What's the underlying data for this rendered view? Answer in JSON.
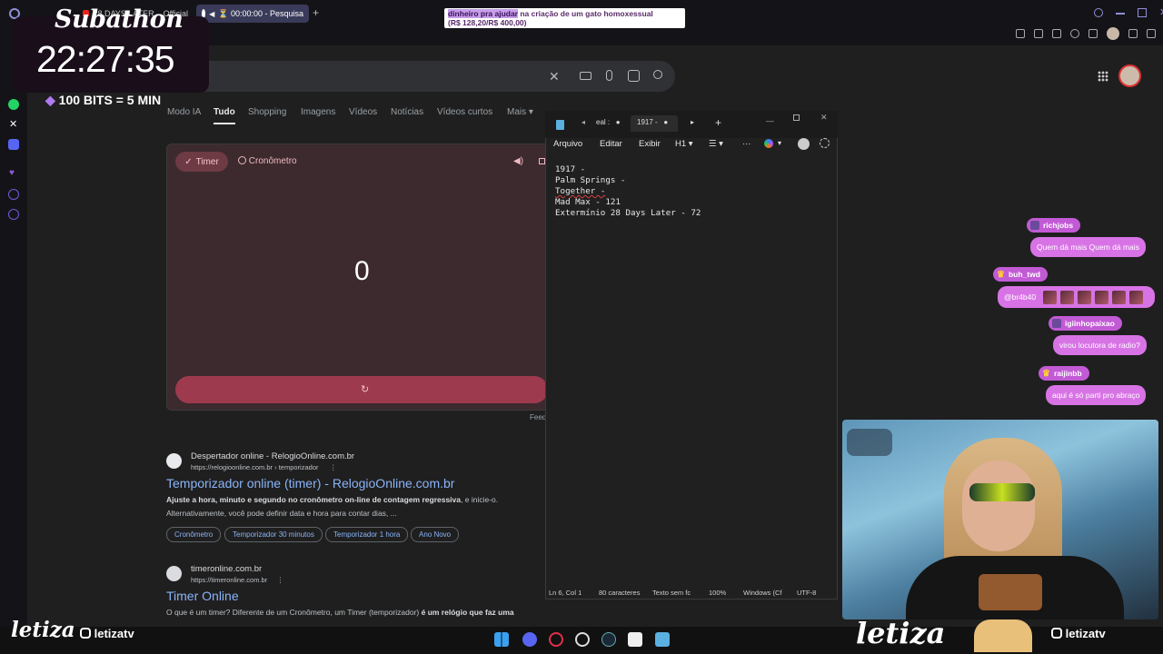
{
  "browser": {
    "tabs": [
      {
        "label": "28 DAYS LATER – Official"
      },
      {
        "label": "⏳ 00:00:00 - Pesquisa"
      }
    ],
    "new_tab": "+"
  },
  "overlay": {
    "subathon": "Subathon",
    "clock": "22:27:35",
    "bits": "100 BITS = 5 MIN",
    "donation_highlight": "dinheiro pra ajudar",
    "donation_text": " na criação de um gato homoxessual",
    "donation_amount": "(R$ 128,20/R$ 400,00)",
    "brand": "letiza",
    "handle": "letizatv",
    "brand_right": "letiza",
    "handle_right": "letizatv"
  },
  "google": {
    "nav": [
      "Modo IA",
      "Tudo",
      "Shopping",
      "Imagens",
      "Vídeos",
      "Notícias",
      "Vídeos curtos",
      "Mais"
    ],
    "selected_nav": "Tudo",
    "timer_tab": "Timer",
    "stopwatch_tab": "Cronômetro",
    "timer_value": "0",
    "feedback": "Feed",
    "results": [
      {
        "site": "Despertador online - RelogioOnline.com.br",
        "url": "https://relogioonline.com.br › temporizador",
        "title": "Temporizador online (timer) - RelogioOnline.com.br",
        "snippet_bold": "Ajuste a hora, minuto e segundo no cronômetro on-line de contagem regressiva",
        "snippet_rest": ", e inicie-o. Alternativamente, você pode definir data e hora para contar dias, ...",
        "chips": [
          "Cronômetro",
          "Temporizador 30 minutos",
          "Temporizador 1 hora",
          "Ano Novo"
        ]
      },
      {
        "site": "timeronline.com.br",
        "url": "https://timeronline.com.br",
        "title": "Timer Online",
        "snippet_rest": "O que é um timer? Diferente de um Cronômetro, um Timer (temporizador) ",
        "snippet_bold": "é um relógio que faz uma"
      }
    ]
  },
  "notepad": {
    "tabs": [
      "eal :",
      "1917 -"
    ],
    "menu": [
      "Arquivo",
      "Editar",
      "Exibir",
      "H1"
    ],
    "lines": [
      "1917 -",
      "Palm Springs -",
      "Together -",
      "Mad Max - 121",
      "Extermínio 28 Days Later - 72"
    ],
    "status": {
      "position": "Ln 6, Col 1",
      "chars": "80 caracteres",
      "format": "Texto sem fc",
      "zoom": "100%",
      "eol": "Windows (Cf",
      "encoding": "UTF-8"
    }
  },
  "chat": [
    {
      "user": "richjobs",
      "message": "Quem dá mais Quem dá mais",
      "emotes": 0
    },
    {
      "user": "buh_twd",
      "message": "@br4b40",
      "emotes": 6
    },
    {
      "user": "igiinhopaixao",
      "message": "virou locutora de radio?",
      "emotes": 0
    },
    {
      "user": "raijinbb",
      "message": "aqui é só parti pro abraço",
      "emotes": 0
    }
  ],
  "colors": {
    "accent_purple": "#c25ad6",
    "chat_bubble": "#d873e6",
    "google_link": "#8ab4f8",
    "timer_card": "#3c2a2e",
    "timer_bar": "#9e3a4e"
  }
}
